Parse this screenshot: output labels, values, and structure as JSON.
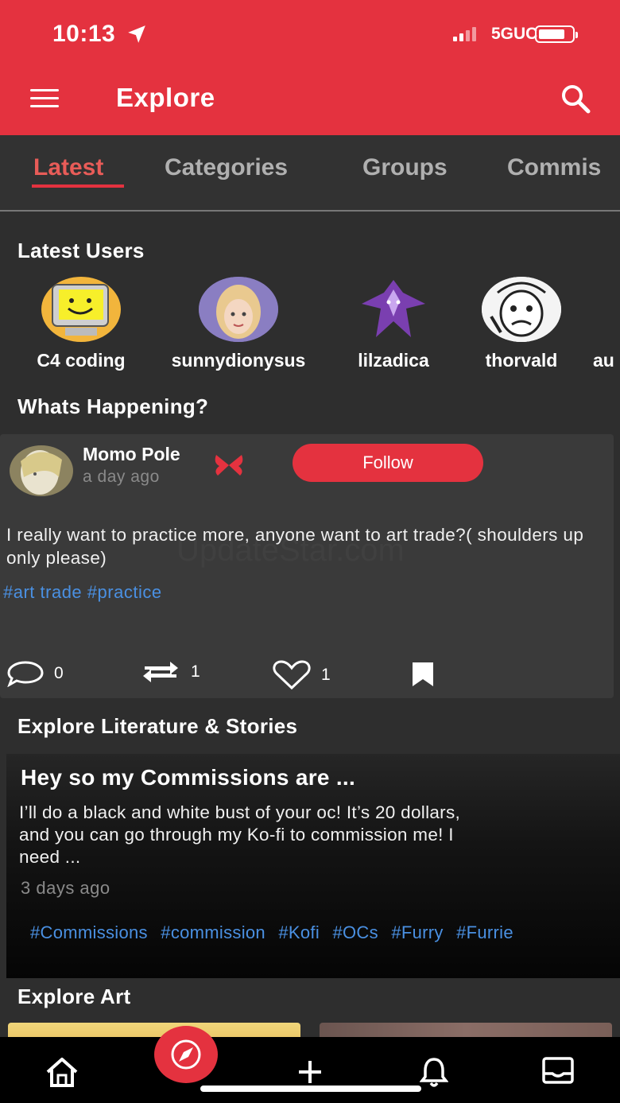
{
  "status_bar": {
    "time": "10:13",
    "network": "5GUC",
    "location_icon": "location-arrow-icon",
    "battery_icon": "battery-icon"
  },
  "header": {
    "title": "Explore",
    "menu_icon": "hamburger-menu-icon",
    "search_icon": "search-icon",
    "background_color": "#e4323f"
  },
  "tabs": [
    {
      "label": "Latest",
      "active": true
    },
    {
      "label": "Categories",
      "active": false
    },
    {
      "label": "Groups",
      "active": false
    },
    {
      "label": "Commis",
      "active": false
    }
  ],
  "latest_users": {
    "title": "Latest Users",
    "users": [
      {
        "name": "C4 coding"
      },
      {
        "name": "sunnydionysus"
      },
      {
        "name": "lilzadica"
      },
      {
        "name": "thorvald"
      },
      {
        "name": "au"
      }
    ]
  },
  "whats_happening": {
    "title": "Whats Happening?",
    "post": {
      "author": "Momo Pole",
      "time": "a day ago",
      "follow_label": "Follow",
      "text": "I really want to practice more, anyone want to art trade?( shoulders up only please)",
      "tags": [
        "#art trade",
        "#practice"
      ],
      "comments": "0",
      "reposts": "1",
      "likes": "1",
      "watermark": "UpdateStar.com"
    }
  },
  "literature": {
    "title": "Explore Literature & Stories",
    "story": {
      "title": "Hey so my Commissions are ...",
      "body": "I’ll do a black and white bust of your oc! It’s 20 dollars, and you can go through my Ko-fi to commission me! I need ...",
      "time": "3 days ago",
      "tags": [
        "#Commissions",
        "#commission",
        "#Kofi",
        "#OCs",
        "#Furry",
        "#Furrie"
      ]
    }
  },
  "art": {
    "title": "Explore Art"
  },
  "bottom_nav": {
    "items": [
      "home-icon",
      "compass-icon",
      "plus-icon",
      "bell-icon",
      "inbox-icon"
    ],
    "accent": "#e4323f"
  }
}
